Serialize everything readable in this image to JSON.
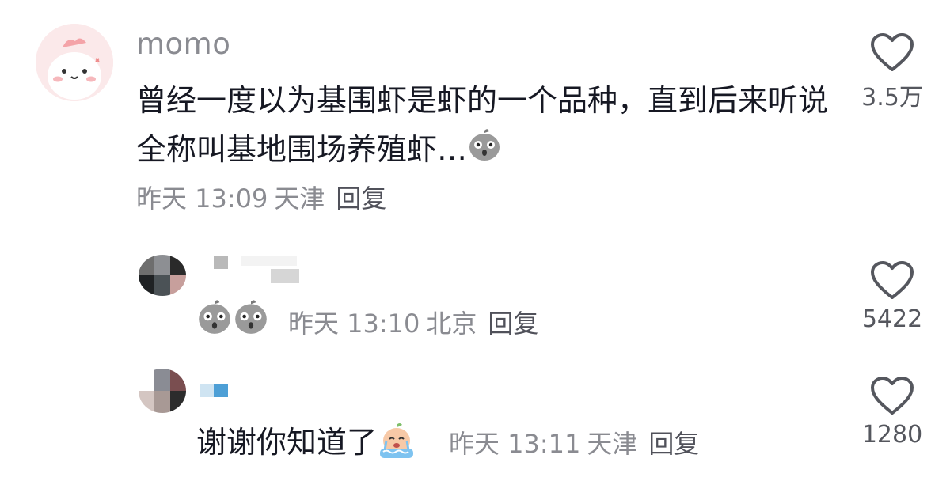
{
  "comment": {
    "username": "momo",
    "text": "曾经一度以为基围虾是虾的一个品种，直到后来听说全称叫基地围场养殖虾…",
    "emoji": "shocked-face-emoji",
    "time": "昨天 13:09",
    "location": "天津",
    "reply_label": "回复",
    "likes": "3.5万"
  },
  "replies": [
    {
      "username": "",
      "text": "",
      "emojis": [
        "shocked-face-emoji",
        "shocked-face-emoji"
      ],
      "time": "昨天 13:10",
      "location": "北京",
      "reply_label": "回复",
      "likes": "5422"
    },
    {
      "username": "",
      "text": "谢谢你知道了",
      "emojis": [
        "crying-face-emoji"
      ],
      "time": "昨天 13:11",
      "location": "天津",
      "reply_label": "回复",
      "likes": "1280"
    }
  ],
  "icons": {
    "like": "heart-outline-icon"
  },
  "colors": {
    "primary_text": "#161823",
    "secondary_text": "#8a8b91",
    "like_icon": "#55575e"
  }
}
